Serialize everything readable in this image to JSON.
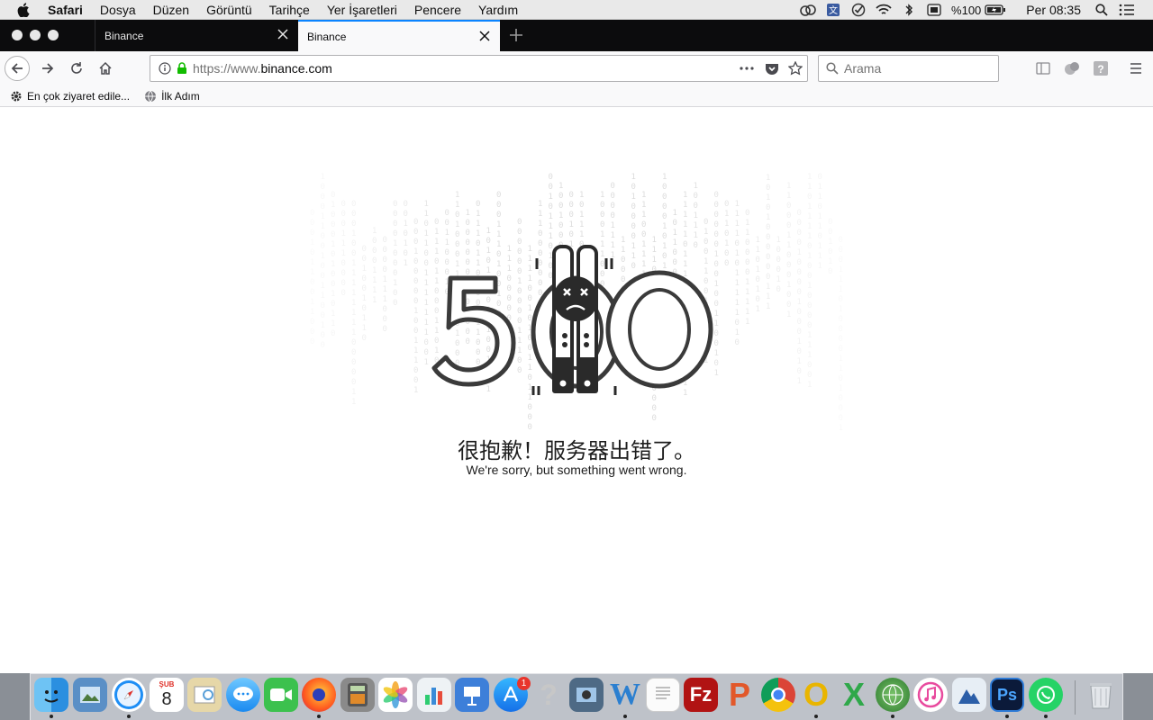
{
  "menubar": {
    "apple_icon": "apple-logo-icon",
    "app_name": "Safari",
    "menus": [
      "Dosya",
      "Düzen",
      "Görüntü",
      "Tarihçe",
      "Yer İşaretleri",
      "Pencere",
      "Yardım"
    ],
    "battery_percent": "%100",
    "clock": "Per 08:35"
  },
  "tabs": [
    {
      "title": "Binance",
      "active": false
    },
    {
      "title": "Binance",
      "active": true
    }
  ],
  "navbar": {
    "url_scheme": "https://www.",
    "url_host": "binance.com",
    "search_placeholder": "Arama"
  },
  "bookmarks": [
    {
      "label": "En çok ziyaret edile...",
      "icon": "gear-icon"
    },
    {
      "label": "İlk Adım",
      "icon": "globe-icon"
    }
  ],
  "page": {
    "error_code": "500",
    "message_zh": "很抱歉！服务器出错了。",
    "message_en": "We're sorry, but something went wrong."
  },
  "dock": {
    "calendar_month": "ŞUB",
    "calendar_day": "8",
    "appstore_badge": "1",
    "apps": [
      "finder",
      "preview",
      "safari",
      "calendar",
      "photo-viewer",
      "messages",
      "facetime",
      "firefox",
      "calculator",
      "photos",
      "numbers",
      "keynote",
      "app-store",
      "help",
      "image-capture",
      "word",
      "textedit",
      "filezilla",
      "powerpoint",
      "chrome",
      "outlook",
      "excel",
      "globe-app",
      "itunes",
      "mountain-app",
      "photoshop",
      "whatsapp",
      "trash"
    ]
  }
}
